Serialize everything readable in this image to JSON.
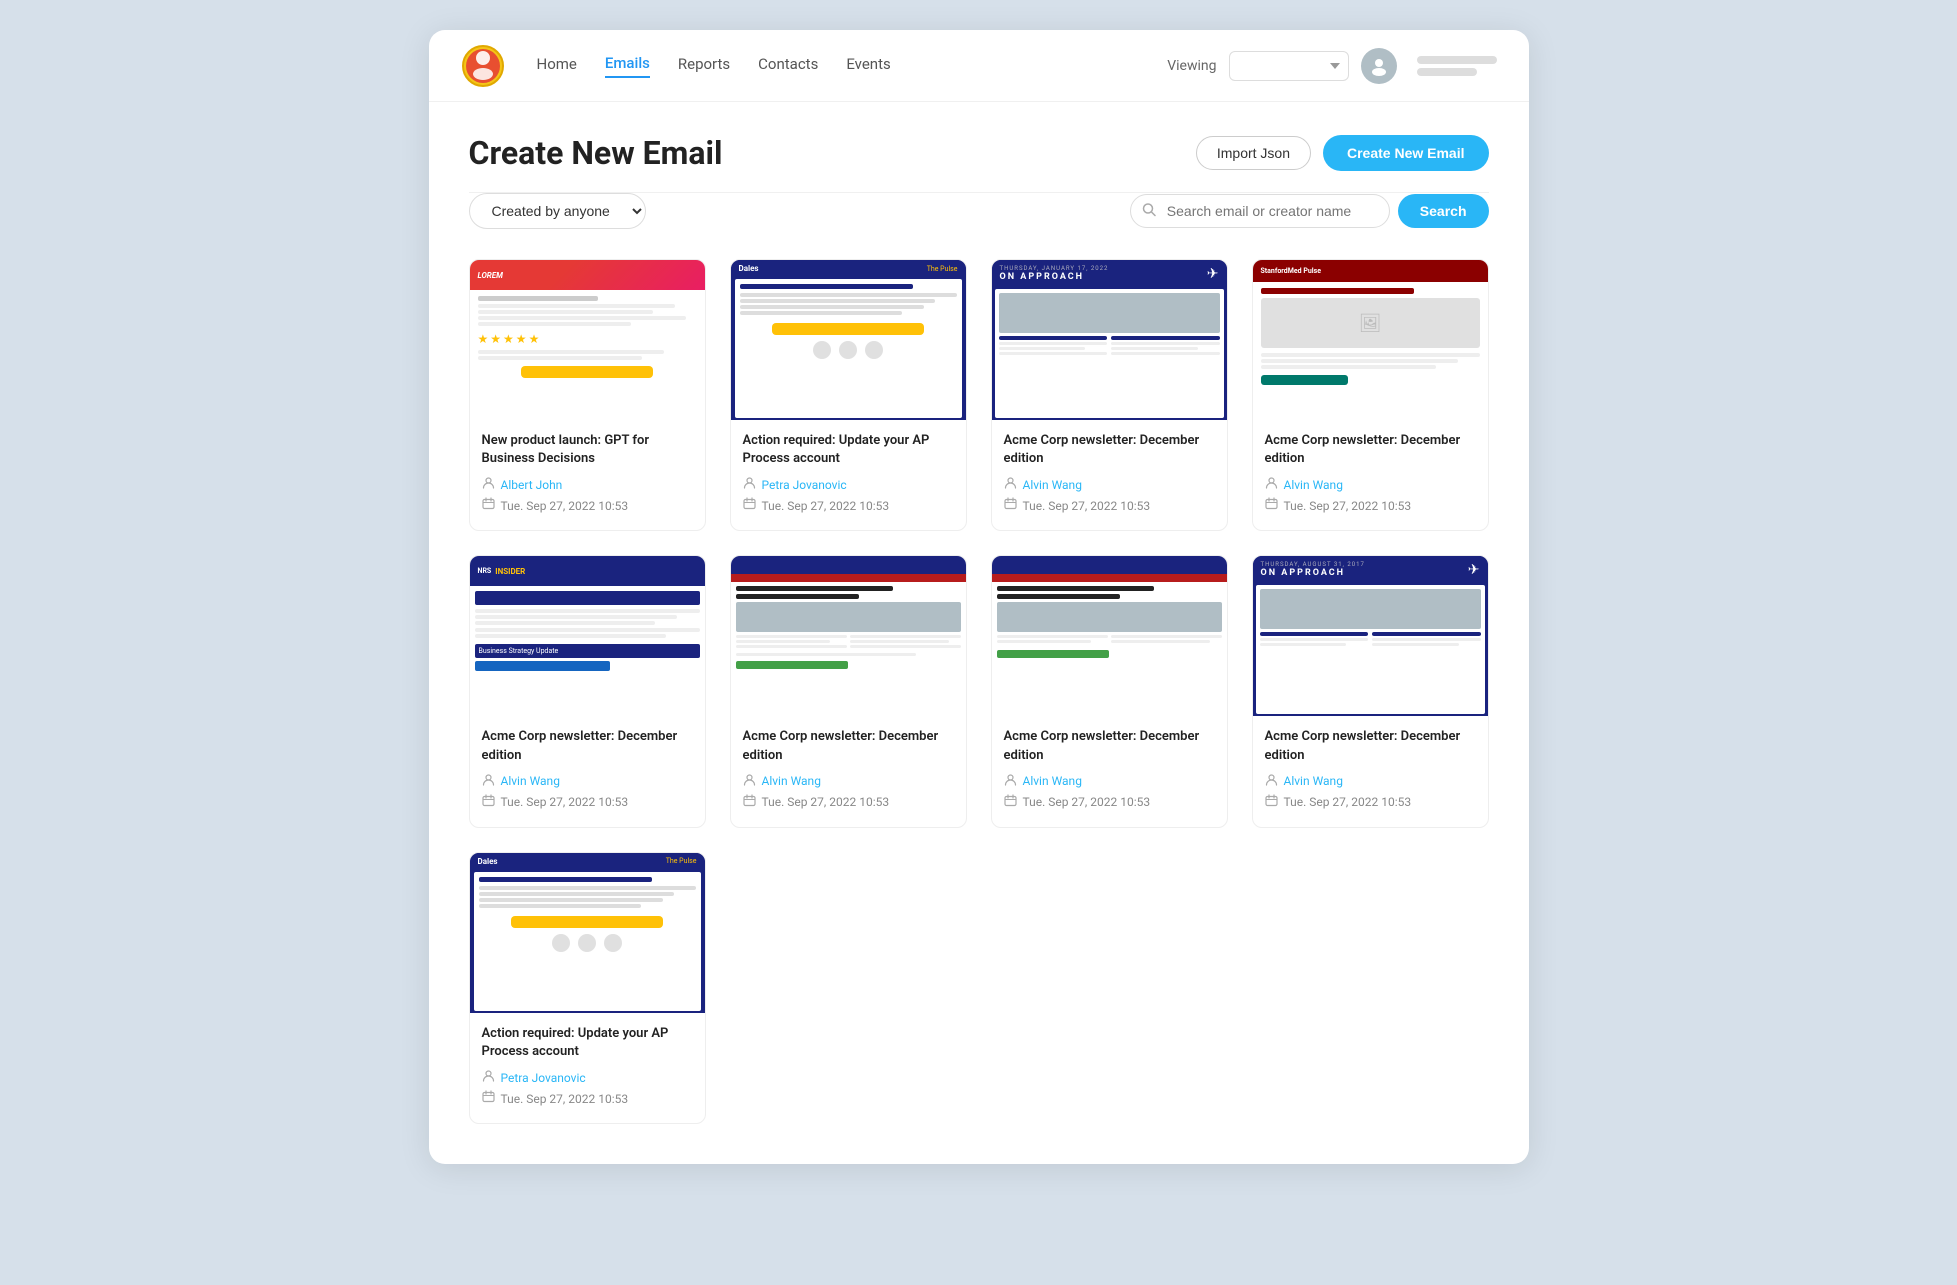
{
  "app": {
    "logo_alt": "App Logo"
  },
  "navbar": {
    "links": [
      {
        "label": "Home",
        "active": false
      },
      {
        "label": "Emails",
        "active": true
      },
      {
        "label": "Reports",
        "active": false
      },
      {
        "label": "Contacts",
        "active": false
      },
      {
        "label": "Events",
        "active": false
      }
    ],
    "viewing_label": "Viewing",
    "viewing_placeholder": "",
    "avatar_initials": ""
  },
  "page": {
    "title": "Create New Email",
    "import_btn": "Import Json",
    "create_btn": "Create New Email"
  },
  "filters": {
    "created_by": "Created by anyone",
    "search_placeholder": "Search email or creator name",
    "search_btn": "Search"
  },
  "emails": [
    {
      "id": 1,
      "title": "New product launch: GPT for Business Decisions",
      "author": "Albert John",
      "date": "Tue. Sep 27, 2022 10:53",
      "thumb_type": "1"
    },
    {
      "id": 2,
      "title": "Action required: Update your AP Process account",
      "author": "Petra Jovanovic",
      "date": "Tue. Sep 27, 2022 10:53",
      "thumb_type": "2"
    },
    {
      "id": 3,
      "title": "Acme Corp newsletter: December edition",
      "author": "Alvin Wang",
      "date": "Tue. Sep 27, 2022 10:53",
      "thumb_type": "3"
    },
    {
      "id": 4,
      "title": "Acme Corp newsletter: December edition",
      "author": "Alvin Wang",
      "date": "Tue. Sep 27, 2022 10:53",
      "thumb_type": "4"
    },
    {
      "id": 5,
      "title": "Acme Corp newsletter: December edition",
      "author": "Alvin Wang",
      "date": "Tue. Sep 27, 2022 10:53",
      "thumb_type": "5"
    },
    {
      "id": 6,
      "title": "Acme Corp newsletter: December edition",
      "author": "Alvin Wang",
      "date": "Tue. Sep 27, 2022 10:53",
      "thumb_type": "6"
    },
    {
      "id": 7,
      "title": "Acme Corp newsletter: December edition",
      "author": "Alvin Wang",
      "date": "Tue. Sep 27, 2022 10:53",
      "thumb_type": "7"
    },
    {
      "id": 8,
      "title": "Acme Corp newsletter: December edition",
      "author": "Alvin Wang",
      "date": "Tue. Sep 27, 2022 10:53",
      "thumb_type": "8"
    },
    {
      "id": 9,
      "title": "Action required: Update your AP Process account",
      "author": "Petra Jovanovic",
      "date": "Tue. Sep 27, 2022 10:53",
      "thumb_type": "2"
    }
  ]
}
